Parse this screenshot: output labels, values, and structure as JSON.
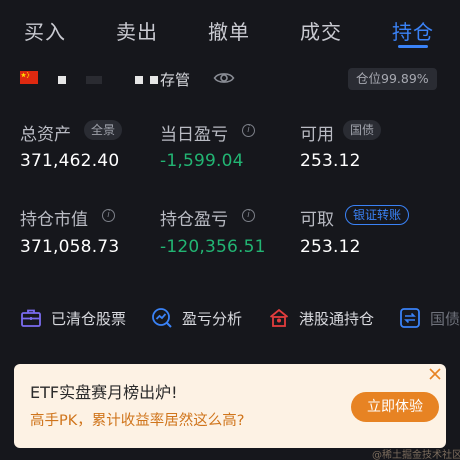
{
  "tabs": [
    {
      "label": "买入"
    },
    {
      "label": "卖出"
    },
    {
      "label": "撤单"
    },
    {
      "label": "成交"
    },
    {
      "label": "持仓"
    }
  ],
  "active_tab": "持仓",
  "account": {
    "label": "存管",
    "position_badge": "仓位99.89%"
  },
  "stats": {
    "total_assets": {
      "label": "总资产",
      "pill": "全景",
      "value": "371,462.40"
    },
    "daily_pnl": {
      "label": "当日盈亏",
      "value": "-1,599.04"
    },
    "available": {
      "label": "可用",
      "pill": "国债",
      "value": "253.12"
    },
    "market_value": {
      "label": "持仓市值",
      "value": "371,058.73"
    },
    "position_pnl": {
      "label": "持仓盈亏",
      "value": "-120,356.51"
    },
    "withdrawable": {
      "label": "可取",
      "pill": "银证转账",
      "value": "253.12"
    }
  },
  "quick_actions": [
    {
      "label": "已清仓股票",
      "icon": "briefcase-icon"
    },
    {
      "label": "盈亏分析",
      "icon": "analysis-icon"
    },
    {
      "label": "港股通持仓",
      "icon": "hk-connect-icon"
    },
    {
      "label": "国债",
      "icon": "transfer-icon"
    }
  ],
  "banner": {
    "title": "ETF实盘赛月榜出炉!",
    "subtitle": "高手PK，累计收益率居然这么高?",
    "button": "立即体验"
  },
  "watermark": "@稀土掘金技术社区",
  "colors": {
    "background": "#16171c",
    "accent": "#3a82f6",
    "loss": "#22b573",
    "banner_bg": "#fdf2e4",
    "banner_button": "#e78323"
  }
}
